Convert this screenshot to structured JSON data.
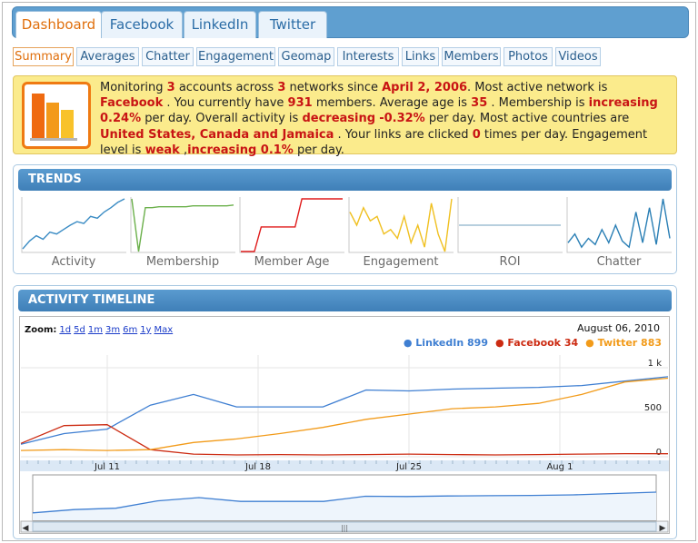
{
  "colors": {
    "linkedin": "#3f7fd2",
    "facebook": "#cc2b12",
    "twitter": "#f29b1a",
    "accent": "#e06f0c"
  },
  "top_tabs": [
    {
      "label": "Dashboard",
      "active": true
    },
    {
      "label": "Facebook",
      "active": false
    },
    {
      "label": "LinkedIn",
      "active": false
    },
    {
      "label": "Twitter",
      "active": false
    }
  ],
  "sub_tabs": [
    {
      "label": "Summary",
      "active": true
    },
    {
      "label": "Averages"
    },
    {
      "label": "Chatter"
    },
    {
      "label": "Engagement"
    },
    {
      "label": "Geomap"
    },
    {
      "label": "Interests"
    },
    {
      "label": "Links"
    },
    {
      "label": "Members"
    },
    {
      "label": "Photos"
    },
    {
      "label": "Videos"
    }
  ],
  "summary": {
    "icon": "bar-chart-icon",
    "t1": "Monitoring ",
    "accounts": "3",
    "t2": " accounts across ",
    "networks": "3",
    "t3": " networks since ",
    "since": "April 2, 2006",
    "t4": ". Most active network is ",
    "most_active": "Facebook",
    "t5": " . You currently have ",
    "members": "931",
    "t6": " members. Average age is ",
    "avg_age": "35",
    "t7": " . Membership is ",
    "membership_trend": "increasing",
    "membership_rate": "0.24%",
    "t8": " per day. Overall activity is ",
    "activity_trend": "decreasing",
    "activity_rate": "-0.32%",
    "t9": " per day. Most active countries are ",
    "countries": "United States, Canada and Jamaica",
    "t10": " . Your links are clicked ",
    "clicks": "0",
    "t11": " times per day. Engagement level is ",
    "engagement_level": "weak",
    "t12": " ,",
    "engagement_trend": "increasing 0.1%",
    "t13": " per day."
  },
  "trends": {
    "title": "TRENDS",
    "items": [
      {
        "label": "Activity",
        "color": "#3b8cc4",
        "values": [
          3,
          12,
          18,
          14,
          22,
          20,
          25,
          30,
          34,
          32,
          40,
          38,
          45,
          50,
          56,
          60
        ]
      },
      {
        "label": "Membership",
        "color": "#6bb04b",
        "values": [
          60,
          0,
          50,
          50,
          51,
          51,
          51,
          51,
          51,
          52,
          52,
          52,
          52,
          52,
          52,
          53
        ]
      },
      {
        "label": "Member Age",
        "color": "#e01b1b",
        "values": [
          0,
          0,
          0,
          28,
          28,
          28,
          28,
          28,
          28,
          60,
          60,
          60,
          60,
          60,
          60,
          60
        ]
      },
      {
        "label": "Engagement",
        "color": "#f0c020",
        "values": [
          45,
          30,
          50,
          35,
          40,
          20,
          25,
          15,
          40,
          10,
          30,
          5,
          55,
          20,
          0,
          60
        ]
      },
      {
        "label": "ROI",
        "color": "#9fbfd4",
        "values": [
          30,
          30,
          30,
          30,
          30,
          30,
          30,
          30,
          30,
          30,
          30,
          30,
          30,
          30,
          30,
          30
        ]
      },
      {
        "label": "Chatter",
        "color": "#2a7fb5",
        "values": [
          10,
          20,
          5,
          15,
          8,
          25,
          10,
          30,
          12,
          5,
          45,
          10,
          50,
          8,
          60,
          15
        ]
      }
    ]
  },
  "timeline": {
    "title": "ACTIVITY TIMELINE",
    "zoom_label": "Zoom:",
    "zoom_options": [
      "1d",
      "5d",
      "1m",
      "3m",
      "6m",
      "1y",
      "Max"
    ],
    "date": "August 06, 2010",
    "legend": [
      "LinkedIn 899",
      "Facebook 34",
      "Twitter 883"
    ],
    "navigator_handle": "|||"
  },
  "chart_data": {
    "type": "line",
    "x": [
      "Jul 6",
      "Jul 9",
      "Jul 11",
      "Jul 13",
      "Jul 15",
      "Jul 17",
      "Jul 19",
      "Jul 21",
      "Jul 23",
      "Jul 25",
      "Jul 27",
      "Jul 29",
      "Jul 31",
      "Aug 2",
      "Aug 4",
      "Aug 6"
    ],
    "x_ticks": [
      "Jul 11",
      "Jul 18",
      "Jul 25",
      "Aug 1"
    ],
    "y_ticks": [
      "0",
      "500",
      "1 k"
    ],
    "ylim": [
      0,
      1000
    ],
    "series": [
      {
        "name": "LinkedIn 899",
        "values": [
          140,
          260,
          310,
          580,
          700,
          560,
          560,
          560,
          750,
          740,
          760,
          770,
          780,
          800,
          850,
          899
        ]
      },
      {
        "name": "Facebook 34",
        "values": [
          150,
          350,
          360,
          80,
          30,
          20,
          25,
          20,
          25,
          30,
          25,
          20,
          25,
          30,
          35,
          34
        ]
      },
      {
        "name": "Twitter 883",
        "values": [
          70,
          80,
          70,
          80,
          160,
          200,
          260,
          330,
          420,
          480,
          540,
          560,
          600,
          700,
          840,
          883
        ]
      }
    ]
  }
}
